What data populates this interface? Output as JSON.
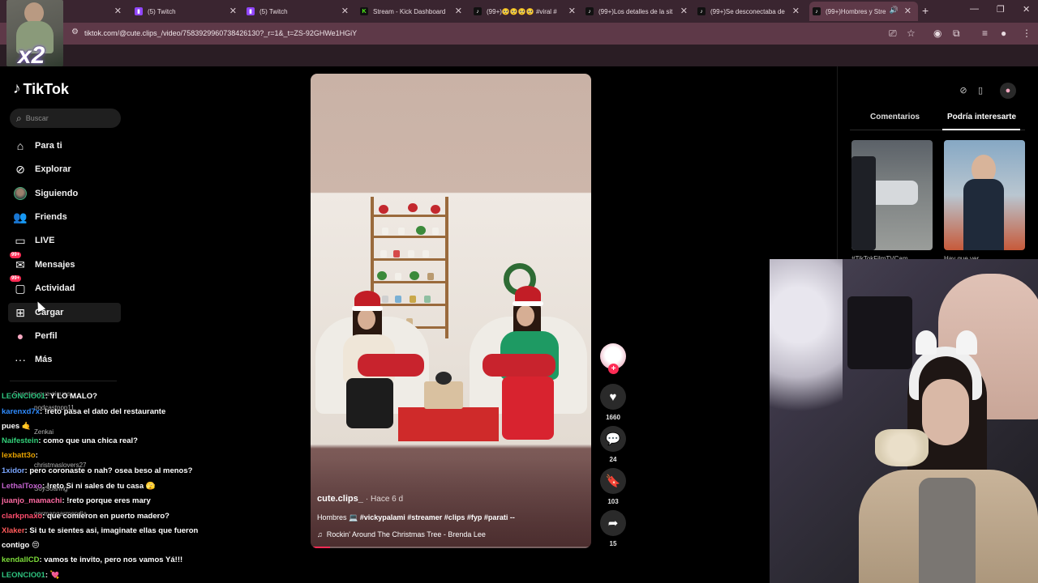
{
  "browser": {
    "tabs": [
      {
        "title": "",
        "icon": "tab-icon"
      },
      {
        "title": "(5) Twitch",
        "icon": "twitch-icon"
      },
      {
        "title": "(5) Twitch",
        "icon": "twitch-icon"
      },
      {
        "title": "Stream - Kick Dashboard",
        "icon": "kick-icon"
      },
      {
        "title": "(99+)🥺🥺🥺🥺 #viral #",
        "icon": "tiktok-icon"
      },
      {
        "title": "(99+)Los detalles de la sit",
        "icon": "tiktok-icon"
      },
      {
        "title": "(99+)Se desconectaba de",
        "icon": "tiktok-icon"
      },
      {
        "title": "(99+)Hombres y Stre",
        "icon": "tiktok-icon"
      }
    ],
    "url": "tiktok.com/@cute.clips_/video/7583929960738426130?_r=1&_t=ZS-92GHWe1HGiY",
    "accent": "#5e3948"
  },
  "overlay": {
    "multiplier": "x2"
  },
  "tiktok": {
    "logo": "TikTok",
    "search_placeholder": "Buscar",
    "nav": [
      {
        "label": "Para ti",
        "icon": "home-icon"
      },
      {
        "label": "Explorar",
        "icon": "compass-icon"
      },
      {
        "label": "Siguiendo",
        "icon": "following-avatar-icon"
      },
      {
        "label": "Friends",
        "icon": "friends-icon"
      },
      {
        "label": "LIVE",
        "icon": "live-icon"
      },
      {
        "label": "Mensajes",
        "icon": "messages-icon",
        "badge": "99+"
      },
      {
        "label": "Actividad",
        "icon": "activity-icon",
        "badge": "99+"
      },
      {
        "label": "Cargar",
        "icon": "upload-icon"
      },
      {
        "label": "Perfil",
        "icon": "profile-icon"
      },
      {
        "label": "Más",
        "icon": "more-icon"
      }
    ],
    "following_header": "Cuentas que sigues",
    "following_accounts": [
      "podcastppp11",
      "Zenkai",
      "christmaslovers27",
      "SoySoaring",
      "germangarmendia"
    ],
    "video": {
      "author": "cute.clips_",
      "time": "Hace 6 d",
      "desc_prefix": "Hombres",
      "hashtags": "#vickypalami #streamer #clips #fyp #parati --",
      "music": "Rockin' Around The Christmas Tree - Brenda Lee",
      "progress": 0.07
    },
    "actions": {
      "likes": "1660",
      "comments": "24",
      "saves": "103",
      "shares": "15"
    },
    "right_panel": {
      "tabs": [
        "Comentarios",
        "Podría interesarte"
      ],
      "active_tab": 1,
      "captions": [
        "#TikTokFilmTVCam",
        "Hay que ver"
      ]
    }
  },
  "chat": [
    {
      "user": "LEONCIO01",
      "color": "#2ec27e",
      "msg": ": Y LO MALO?"
    },
    {
      "user": "karenxd7x",
      "color": "#2f8cff",
      "msg": ": !reto pasa el dato del restaurante"
    },
    {
      "user": "",
      "color": "#ffffff",
      "msg": "pues 🤙"
    },
    {
      "user": "Naifestein",
      "color": "#33d17a",
      "msg": ": como que una chica real?"
    },
    {
      "user": "lexbatt3o",
      "color": "#e6a200",
      "msg": ":"
    },
    {
      "user": "1xidor",
      "color": "#7aa6ff",
      "msg": ": pero coronaste o nah? osea beso al menos?"
    },
    {
      "user": "LethalToxo",
      "color": "#c061cb",
      "msg": ": !reto Si ni sales de tu casa 🫣"
    },
    {
      "user": "juanjo_mamachi",
      "color": "#ff6aa2",
      "msg": ": !reto porque eres mary"
    },
    {
      "user": "clarkpnaxo",
      "color": "#ff4d6d",
      "msg": ": que comieron en puerto madero?"
    },
    {
      "user": "Xlaker",
      "color": "#ff5a5a",
      "msg": ": Si tu te sientes asi, imaginate ellas que fueron"
    },
    {
      "user": "",
      "color": "#ffffff",
      "msg": "contigo 😔"
    },
    {
      "user": "kendallCD",
      "color": "#7ddc3a",
      "msg": ": vamos te invito, pero nos vamos Yá!!!"
    },
    {
      "user": "LEONCIO01",
      "color": "#2ec27e",
      "msg": ": 💘"
    }
  ]
}
